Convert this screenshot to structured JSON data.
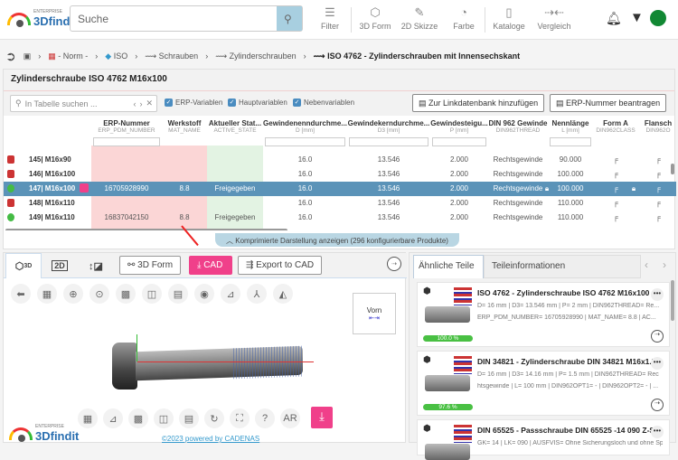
{
  "header": {
    "logo_small": "ENTERPRISE",
    "logo_big": "3Dfindit",
    "search_placeholder": "Suche",
    "tools": [
      {
        "label": "Filter",
        "icon": "sliders-icon"
      },
      {
        "label": "3D Form",
        "icon": "cube-icon"
      },
      {
        "label": "2D Skizze",
        "icon": "pencil-icon"
      },
      {
        "label": "Farbe",
        "icon": "palette-icon"
      },
      {
        "label": "Kataloge",
        "icon": "catalog-icon"
      },
      {
        "label": "Vergleich",
        "icon": "compare-icon"
      }
    ]
  },
  "breadcrumb": [
    "- Norm -",
    "ISO",
    "Schrauben",
    "Zylinderschrauben",
    "ISO 4762 - Zylinderschrauben mit Innensechskant"
  ],
  "panel": {
    "title": "Zylinderschraube ISO 4762 M16x100",
    "table_search_placeholder": "In Tabelle suchen ...",
    "checks": [
      "ERP-Variablen",
      "Hauptvariablen",
      "Nebenvariablen"
    ],
    "btn_link": "Zur Linkdatenbank hinzufügen",
    "btn_erp": "ERP-Nummer beantragen",
    "columns": [
      {
        "t": "ERP-Nummer",
        "s": "ERP_PDM_NUMBER"
      },
      {
        "t": "Werkstoff",
        "s": "MAT_NAME"
      },
      {
        "t": "Aktueller Stat...",
        "s": "ACTIVE_STATE"
      },
      {
        "t": "Gewindenenndurchme...",
        "s": "D [mm]"
      },
      {
        "t": "Gewindekerndurchme...",
        "s": "D3 [mm]"
      },
      {
        "t": "Gewindesteigu...",
        "s": "P [mm]"
      },
      {
        "t": "DIN 962 Gewinde",
        "s": "DIN962THREAD"
      },
      {
        "t": "Nennlänge",
        "s": "L [mm]"
      },
      {
        "t": "Form A",
        "s": "DIN962CLASS"
      },
      {
        "t": "Flansch",
        "s": "DIN962O"
      }
    ],
    "rows": [
      {
        "n": "145| M16x90",
        "erp": "",
        "mat": "",
        "state": "",
        "d": "16.0",
        "d3": "13.546",
        "p": "2.000",
        "thr": "Rechtsgewinde",
        "l": "90.000",
        "status": "red"
      },
      {
        "n": "146| M16x100",
        "erp": "",
        "mat": "",
        "state": "",
        "d": "16.0",
        "d3": "13.546",
        "p": "2.000",
        "thr": "Rechtsgewinde",
        "l": "100.000",
        "status": "red"
      },
      {
        "n": "147| M16x100",
        "erp": "16705928990",
        "mat": "8.8",
        "state": "Freigegeben",
        "d": "16.0",
        "d3": "13.546",
        "p": "2.000",
        "thr": "Rechtsgewinde",
        "l": "100.000",
        "status": "green"
      },
      {
        "n": "148| M16x110",
        "erp": "",
        "mat": "",
        "state": "",
        "d": "16.0",
        "d3": "13.546",
        "p": "2.000",
        "thr": "Rechtsgewinde",
        "l": "110.000",
        "status": "red"
      },
      {
        "n": "149| M16x110",
        "erp": "16837042150",
        "mat": "8.8",
        "state": "Freigegeben",
        "d": "16.0",
        "d3": "13.546",
        "p": "2.000",
        "thr": "Rechtsgewinde",
        "l": "110.000",
        "status": "green"
      }
    ],
    "selected_index": 2,
    "compress": "Komprimierte Darstellung anzeigen (296 konfigurierbare Produkte)"
  },
  "viewer": {
    "tab3d": "3D",
    "tab2d": "2D",
    "btn_form": "3D Form",
    "btn_cad": "CAD",
    "btn_export": "Export to CAD",
    "cube_label": "Vorn",
    "footer": "©2023 powered by CADENAS",
    "accent": "#f0408a"
  },
  "right": {
    "tabs": [
      "Ähnliche Teile",
      "Teileinformationen"
    ],
    "cards": [
      {
        "title": "ISO 4762 - Zylinderschraube ISO 4762 M16x100",
        "l1": "D= 16 mm | D3= 13.546 mm | P= 2 mm | DIN962THREAD= Re...",
        "l2": "ERP_PDM_NUMBER= 16705928990 | MAT_NAME= 8.8 | AC...",
        "pct": "100.0 %"
      },
      {
        "title": "DIN 34821 - Zylinderschraube DIN 34821 M16x1.5...",
        "l1": "D= 16 mm | D3= 14.16 mm | P= 1.5 mm | DIN962THREAD= Rec",
        "l2": "htsgewinde | L= 100 mm | DIN962OPT1= - | DIN962OPT2= - | ...",
        "pct": "97.6 %"
      },
      {
        "title": "DIN 65525 - Passschraube DIN 65525 -14 090 Z-S...",
        "l1": "GK= 14 | LK= 090 | AUSFVIS= Ohne Sicherungsloch und ohne Sp",
        "l2": "",
        "pct": ""
      }
    ]
  }
}
